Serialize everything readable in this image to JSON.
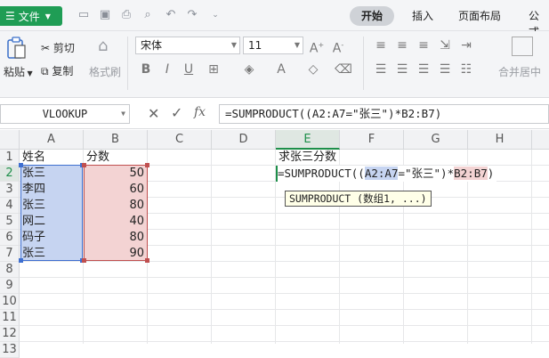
{
  "titlebar": {
    "file_menu": "文件",
    "tabs": [
      "开始",
      "插入",
      "页面布局",
      "公式"
    ]
  },
  "ribbon": {
    "clipboard": {
      "paste": "粘贴",
      "cut": "剪切",
      "copy": "复制",
      "format_painter": "格式刷"
    },
    "font_name": "宋体",
    "font_size": "11",
    "merge_center": "合并居中"
  },
  "formula_bar": {
    "name_box": "VLOOKUP",
    "fx_label": "fx",
    "formula": "=SUMPRODUCT((A2:A7=\"张三\")*B2:B7)"
  },
  "sheet": {
    "columns": [
      "A",
      "B",
      "C",
      "D",
      "E",
      "F",
      "G",
      "H"
    ],
    "rows": [
      "1",
      "2",
      "3",
      "4",
      "5",
      "6",
      "7",
      "8",
      "9",
      "10",
      "11",
      "12",
      "13"
    ],
    "headers": {
      "name": "姓名",
      "score": "分数"
    },
    "data": [
      {
        "name": "张三",
        "score": "50"
      },
      {
        "name": "李四",
        "score": "60"
      },
      {
        "name": "张三",
        "score": "80"
      },
      {
        "name": "网二",
        "score": "40"
      },
      {
        "name": "码子",
        "score": "80"
      },
      {
        "name": "张三",
        "score": "90"
      }
    ],
    "e1_label": "求张三分数",
    "active_column": "E",
    "active_row": "2",
    "cell_formula": {
      "prefix": "=SUMPRODUCT((",
      "ref_a": "A2:A7",
      "middle": "=\"张三\")*",
      "ref_b": "B2:B7",
      "suffix": ")"
    },
    "tooltip": "SUMPRODUCT (数组1, ...)"
  },
  "colors": {
    "file_green": "#1f9d55",
    "ref_blue": "#c6d4f1",
    "ref_red": "#f3d3d3",
    "active_green": "#1e8f4a"
  }
}
